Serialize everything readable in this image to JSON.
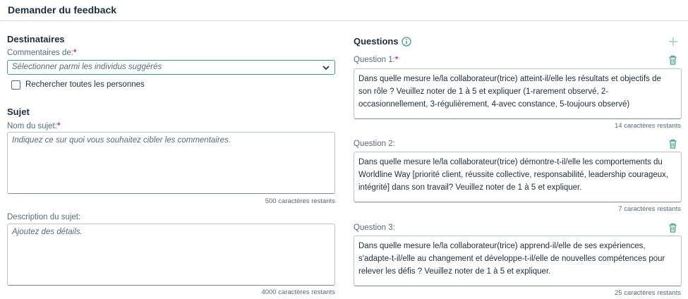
{
  "header": {
    "title": "Demander du feedback"
  },
  "recipients": {
    "title": "Destinataires",
    "label": "Commentaires de:",
    "required_mark": "*",
    "select_placeholder": "Sélectionner parmi les individus suggérés",
    "checkbox_label": "Rechercher toutes les personnes",
    "checkbox_checked": false
  },
  "subject": {
    "title": "Sujet",
    "name_label": "Nom du sujet:",
    "required_mark": "*",
    "name_placeholder": "Indiquez ce sur quoi vous souhaitez cibler les commentaires.",
    "name_counter": "500 caractères restants",
    "desc_label": "Description du sujet:",
    "desc_placeholder": "Ajoutez des détails.",
    "desc_counter": "4000 caractères restants"
  },
  "questions": {
    "title": "Questions",
    "info_icon": "info-icon",
    "add_icon": "plus-icon",
    "items": [
      {
        "label": "Question 1:",
        "required_mark": "*",
        "text": "Dans quelle mesure le/la collaborateur(trice) atteint-il/elle les résultats et objectifs de son rôle ? Veuillez noter de 1 à 5 et expliquer (1-rarement observé, 2-occasionnellement, 3-régulièrement, 4-avec constance, 5-toujours observé)",
        "counter": "14 caractères restants"
      },
      {
        "label": "Question 2:",
        "required_mark": "",
        "text": "Dans quelle mesure le/la collaborateur(trice) démontre-t-il/elle les comportements du Worldline Way [priorité client, réussite collective, responsabilité, leadership courageux, intégrité] dans son travail? Veuillez noter de 1 à 5 et expliquer.",
        "counter": "7 caractères restants"
      },
      {
        "label": "Question 3:",
        "required_mark": "",
        "text": "Dans quelle mesure le/la collaborateur(trice) apprend-il/elle de ses expériences, s'adapte-t-il/elle au changement et développe-t-il/elle de nouvelles compétences pour relever les défis ? Veuillez noter de 1 à 5 et expliquer.",
        "counter": "25 caractères restants"
      }
    ]
  },
  "colors": {
    "accent": "#3c9f8a",
    "required": "#c0399f",
    "text": "#1d2d3e",
    "muted": "#556b82"
  }
}
